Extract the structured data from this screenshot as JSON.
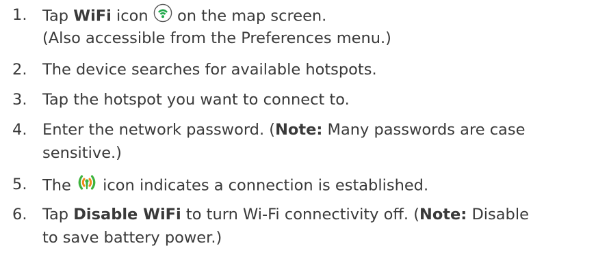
{
  "colors": {
    "text": "#3a3a3a",
    "wifi_icon": "#1ea84a",
    "connected_icon_green": "#3cb33c",
    "connected_icon_orange": "#f08a1c"
  },
  "steps": [
    {
      "number": "1.",
      "l1_a": "Tap ",
      "l1_bold": "WiFi",
      "l1_b": " icon ",
      "l1_icon": "wifi-icon",
      "l1_c": " on the map screen.",
      "l2": "(Also accessible from the Preferences menu.)"
    },
    {
      "number": "2.",
      "text": "The device searches for available hotspots."
    },
    {
      "number": "3.",
      "text": "Tap the hotspot you want to connect to."
    },
    {
      "number": "4.",
      "l1_a": "Enter the network password. (",
      "l1_bold": "Note:",
      "l1_b": " Many passwords are case",
      "l2": "sensitive.)"
    },
    {
      "number": "5.",
      "a": "The ",
      "icon": "wifi-connected-icon",
      "b": " icon indicates a connection is established."
    },
    {
      "number": "6.",
      "l1_a": "Tap ",
      "l1_bold": "Disable WiFi",
      "l1_b": " to turn Wi-Fi connectivity off. (",
      "l1_bold2": "Note:",
      "l1_c": " Disable",
      "l2": "to save battery power.)"
    }
  ]
}
